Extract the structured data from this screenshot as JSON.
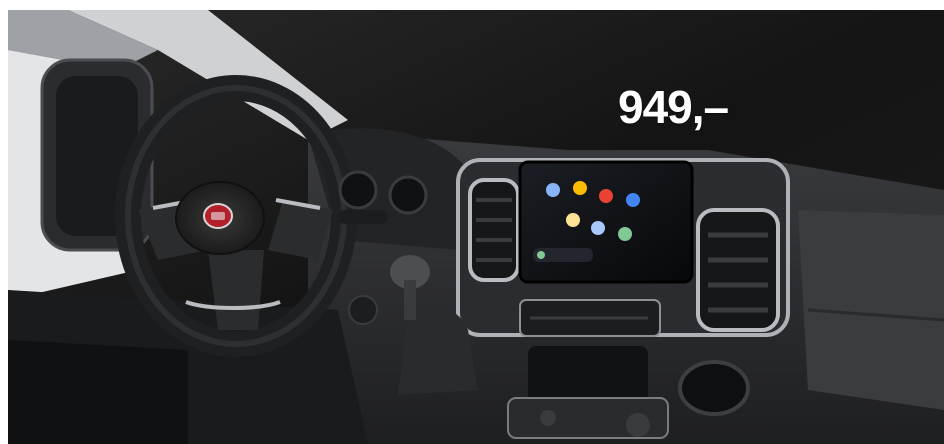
{
  "product": {
    "price": "949,–"
  },
  "colors": {
    "background": "#1a1a1a",
    "dashboard": "#2e2f31",
    "trim_silver": "#b9bcc0",
    "screen": "#0f1114",
    "app_icons": [
      "#8ab4f8",
      "#fbbc04",
      "#ea4335",
      "#4285f4",
      "#fde293",
      "#a8c7fa",
      "#81c995"
    ]
  },
  "icons": [
    "steering-wheel",
    "fiat-logo",
    "infotainment-screen",
    "air-vent",
    "gear-shifter",
    "cup-holder"
  ]
}
